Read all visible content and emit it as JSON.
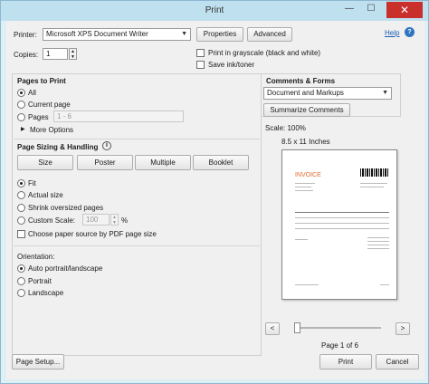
{
  "window": {
    "title": "Print",
    "minimize": "—",
    "maximize": "☐",
    "close": "✕"
  },
  "printer": {
    "label": "Printer:",
    "value": "Microsoft XPS Document Writer",
    "properties": "Properties",
    "advanced": "Advanced",
    "help": "Help"
  },
  "copies": {
    "label": "Copies:",
    "value": "1"
  },
  "options": {
    "grayscale": "Print in grayscale (black and white)",
    "save_ink": "Save ink/toner"
  },
  "pages_to_print": {
    "title": "Pages to Print",
    "all": "All",
    "current_page": "Current page",
    "pages": "Pages",
    "pages_value": "1 - 6",
    "more_options": "More Options"
  },
  "sizing": {
    "title": "Page Sizing & Handling",
    "size": "Size",
    "poster": "Poster",
    "multiple": "Multiple",
    "booklet": "Booklet",
    "fit": "Fit",
    "actual_size": "Actual size",
    "shrink": "Shrink oversized pages",
    "custom_scale": "Custom Scale:",
    "custom_value": "100",
    "percent": "%",
    "paper_source": "Choose paper source by PDF page size"
  },
  "orientation": {
    "title": "Orientation:",
    "auto": "Auto portrait/landscape",
    "portrait": "Portrait",
    "landscape": "Landscape"
  },
  "comments": {
    "title": "Comments & Forms",
    "value": "Document and Markups",
    "summarize": "Summarize Comments"
  },
  "preview": {
    "scale": "Scale: 100%",
    "paper_size": "8.5 x 11 Inches",
    "invoice_label": "INVOICE",
    "page_indicator": "Page 1 of 6",
    "prev": "<",
    "next": ">"
  },
  "footer": {
    "page_setup": "Page Setup...",
    "print": "Print",
    "cancel": "Cancel"
  },
  "colors": {
    "accent_orange": "#e06a2c",
    "title_bar": "#bfe0ef",
    "close_red": "#c9302c"
  }
}
